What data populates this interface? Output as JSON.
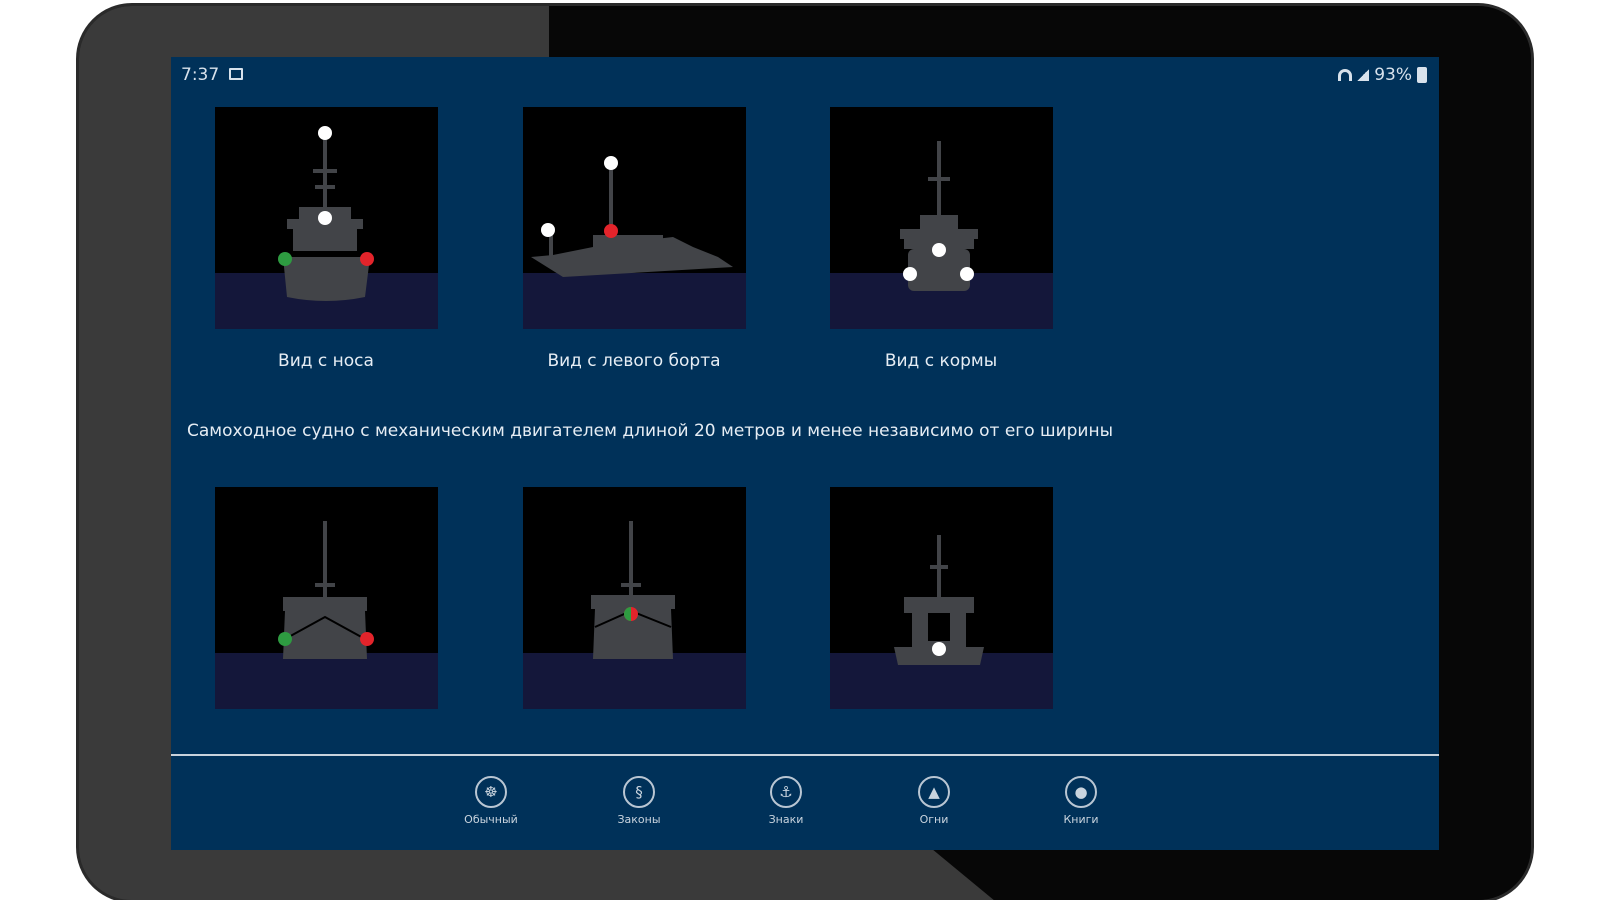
{
  "status_bar": {
    "time": "7:37",
    "battery": "93%"
  },
  "views_row_1": {
    "captions": [
      "Вид с носа",
      "Вид с левого борта",
      "Вид с кормы"
    ]
  },
  "description": "Самоходное судно с механическим двигателем длиной 20 метров и менее независимо от его ширины",
  "bottom_nav": {
    "items": [
      {
        "label": "Обычный",
        "icon": "ship-wheel-icon"
      },
      {
        "label": "Законы",
        "icon": "law-icon"
      },
      {
        "label": "Знаки",
        "icon": "anchor-icon"
      },
      {
        "label": "Огни",
        "icon": "lighthouse-icon"
      },
      {
        "label": "Книги",
        "icon": "person-icon"
      }
    ]
  },
  "colors": {
    "screen_background": "#003159",
    "tile_sky": "#000000",
    "tile_sea": "#14173a",
    "ship": "#424448",
    "light_white": "#ffffff",
    "light_green": "#2e9b41",
    "light_red": "#e3242b"
  }
}
